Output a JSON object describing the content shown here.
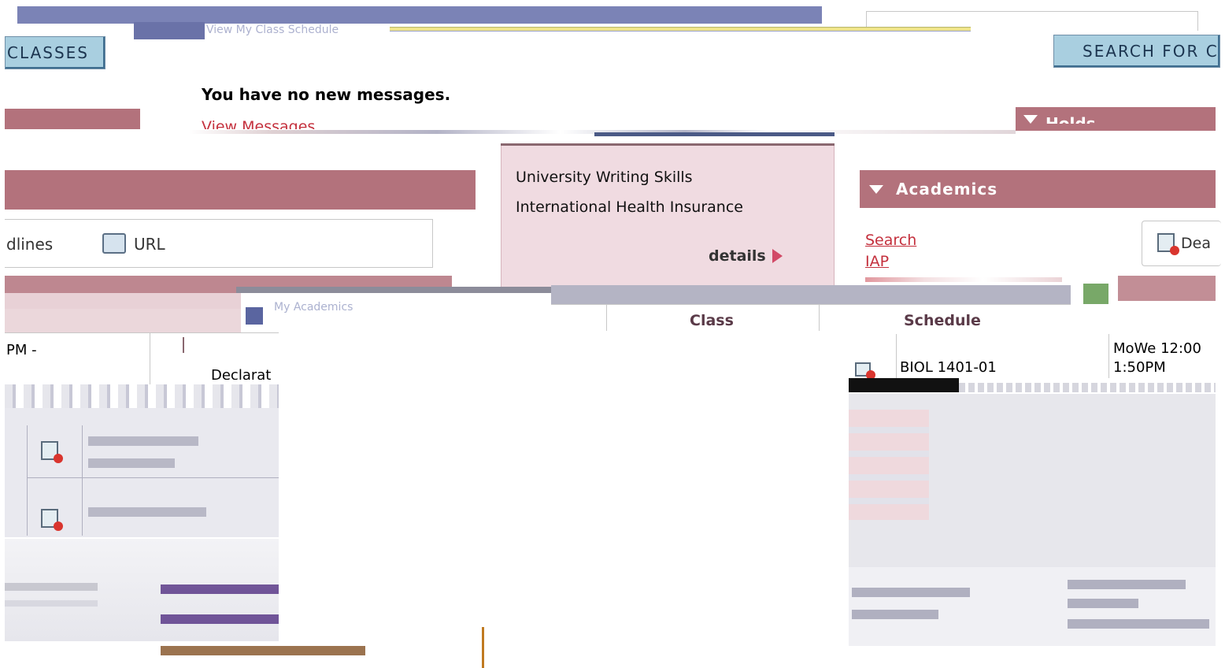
{
  "top_bar": {
    "partial_text": "View My Class Schedule"
  },
  "buttons": {
    "classes": "CLASSES",
    "search_for": "SEARCH FOR C"
  },
  "messages": {
    "no_new": "You have no new messages.",
    "view_link": "View Messages"
  },
  "holds": {
    "title": "Holds"
  },
  "todo_panel": {
    "items": [
      "University Writing Skills",
      "International Health Insurance"
    ],
    "details_label": "details"
  },
  "academics": {
    "title": "Academics",
    "links": [
      "Search",
      "IAP"
    ],
    "deadlines_button": "Dea"
  },
  "toolbar": {
    "deadlines_label": "dlines",
    "url_label": "URL"
  },
  "schedule_table": {
    "headers": [
      "Class",
      "Schedule"
    ],
    "left_time_fragment": "PM -",
    "declaration_fragment": "Declarat",
    "my_academics_fragment": "My Academics",
    "row": {
      "class": "BIOL 1401-01",
      "schedule": "MoWe 12:00 - 1:50PM"
    },
    "schedule_line1": "MoWe 12:00",
    "schedule_line2": "1:50PM"
  },
  "colors": {
    "accent_blue": "#7b83b6",
    "accent_rose": "#b3727c",
    "panel_pink": "#f0dbe1",
    "button_blue": "#a9cfe0",
    "link_red": "#c4303d"
  }
}
